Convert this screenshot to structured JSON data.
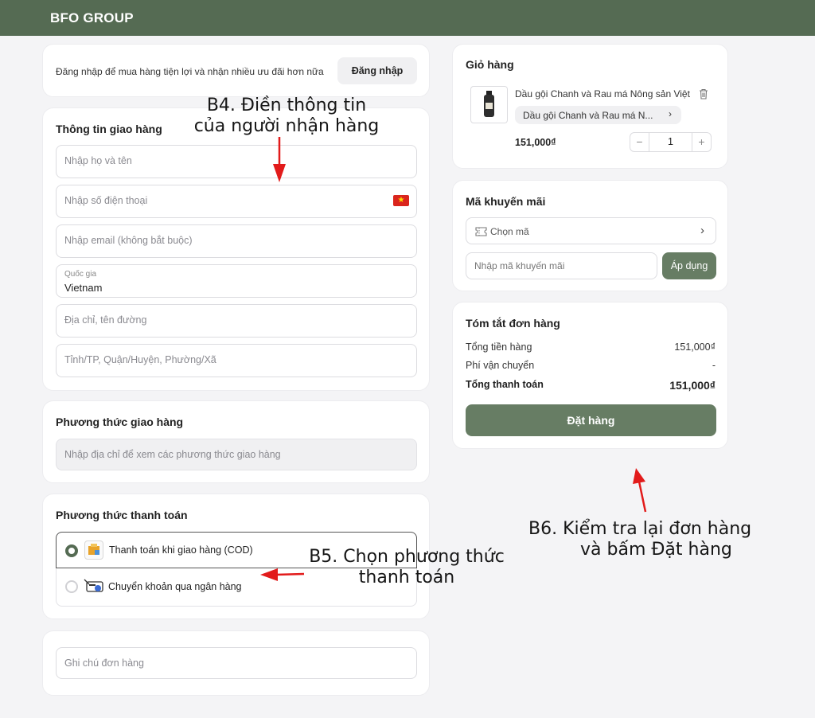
{
  "header": {
    "brand": "BFO GROUP"
  },
  "login": {
    "message": "Đăng nhập để mua hàng tiện lợi và nhận nhiều ưu đãi hơn nữa",
    "button": "Đăng nhập"
  },
  "shipping_info": {
    "title": "Thông tin giao hàng",
    "name_placeholder": "Nhập họ và tên",
    "phone_placeholder": "Nhập số điện thoại",
    "email_placeholder": "Nhập email (không bắt buộc)",
    "country_label": "Quốc gia",
    "country_value": "Vietnam",
    "address_placeholder": "Địa chỉ, tên đường",
    "region_placeholder": "Tỉnh/TP, Quận/Huyện, Phường/Xã"
  },
  "shipping_method": {
    "title": "Phương thức giao hàng",
    "placeholder": "Nhập địa chỉ để xem các phương thức giao hàng"
  },
  "payment_method": {
    "title": "Phương thức thanh toán",
    "options": [
      {
        "label": "Thanh toán khi giao hàng (COD)",
        "selected": true
      },
      {
        "label": "Chuyển khoản qua ngân hàng",
        "selected": false
      }
    ]
  },
  "note": {
    "placeholder": "Ghi chú đơn hàng"
  },
  "cart": {
    "title": "Giỏ hàng",
    "item": {
      "name": "Dầu gội Chanh và Rau má Nông sản Việt",
      "variant": "Dầu gội Chanh và Rau má N...",
      "price": "151,000₫",
      "quantity": "1"
    }
  },
  "promo": {
    "title": "Mã khuyến mãi",
    "choose_label": "Chọn mã",
    "input_placeholder": "Nhập mã khuyến mãi",
    "apply_button": "Áp dụng"
  },
  "summary": {
    "title": "Tóm tắt đơn hàng",
    "subtotal_label": "Tổng tiền hàng",
    "subtotal_value": "151,000₫",
    "shipping_label": "Phí vận chuyển",
    "shipping_value": "-",
    "total_label": "Tổng thanh toán",
    "total_value": "151,000₫",
    "order_button": "Đặt hàng"
  },
  "annotations": {
    "b4_line1": "B4. Điền thông tin",
    "b4_line2": "của người nhận hàng",
    "b5_line1": "B5.  Chọn phương thức",
    "b5_line2": "thanh toán",
    "b6_line1": "B6.  Kiểm tra lại đơn hàng",
    "b6_line2": "và bấm Đặt hàng"
  },
  "colors": {
    "brand": "#556b53",
    "button": "#677d64",
    "annotation_arrow": "#e21b1b"
  }
}
